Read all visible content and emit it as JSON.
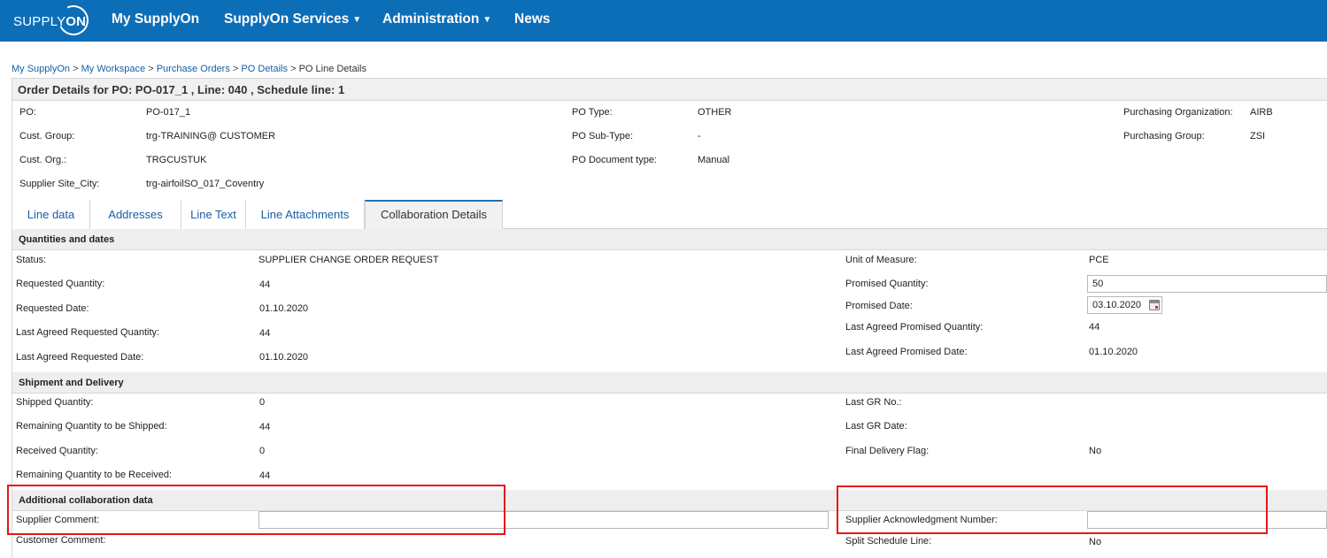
{
  "header": {
    "logo_prefix": "SUPPLY",
    "logo_suffix": "ON",
    "nav": [
      "My SupplyOn",
      "SupplyOn Services",
      "Administration",
      "News"
    ]
  },
  "breadcrumb": {
    "items": [
      "My SupplyOn",
      "My Workspace",
      "Purchase Orders",
      "PO Details"
    ],
    "current": "PO Line Details",
    "separator": ">"
  },
  "title": "Order  Details for PO: PO-017_1 , Line: 040 , Schedule line: 1",
  "po_header": {
    "po_label": "PO:",
    "po_value": "PO-017_1",
    "cust_group_label": "Cust. Group:",
    "cust_group_value": "trg-TRAINING@ CUSTOMER",
    "cust_org_label": "Cust. Org.:",
    "cust_org_value": "TRGCUSTUK",
    "supplier_site_label": "Supplier Site_City:",
    "supplier_site_value": "trg-airfoilSO_017_Coventry",
    "po_type_label": "PO Type:",
    "po_type_value": "OTHER",
    "po_subtype_label": "PO Sub-Type:",
    "po_subtype_value": "-",
    "po_doctype_label": "PO Document type:",
    "po_doctype_value": "Manual",
    "purch_org_label": "Purchasing Organization:",
    "purch_org_value": "AIRB",
    "purch_group_label": "Purchasing Group:",
    "purch_group_value": "ZSI"
  },
  "tabs": [
    "Line data",
    "Addresses",
    "Line Text",
    "Line Attachments",
    "Collaboration Details"
  ],
  "active_tab": "Collaboration Details",
  "quantities": {
    "section_title": "Quantities and dates",
    "status_label": "Status:",
    "status_value": "SUPPLIER CHANGE ORDER REQUEST",
    "req_qty_label": "Requested Quantity:",
    "req_qty_value": "44",
    "req_date_label": "Requested Date:",
    "req_date_value": "01.10.2020",
    "last_req_qty_label": "Last Agreed Requested Quantity:",
    "last_req_qty_value": "44",
    "last_req_date_label": "Last Agreed Requested Date:",
    "last_req_date_value": "01.10.2020",
    "uom_label": "Unit of Measure:",
    "uom_value": "PCE",
    "prom_qty_label": "Promised Quantity:",
    "prom_qty_value": "50",
    "prom_date_label": "Promised Date:",
    "prom_date_value": "03.10.2020",
    "last_prom_qty_label": "Last Agreed Promised Quantity:",
    "last_prom_qty_value": "44",
    "last_prom_date_label": "Last Agreed Promised Date:",
    "last_prom_date_value": "01.10.2020"
  },
  "shipment": {
    "section_title": "Shipment and Delivery",
    "shipped_label": "Shipped Quantity:",
    "shipped_value": "0",
    "remain_ship_label": "Remaining Quantity to be Shipped:",
    "remain_ship_value": "44",
    "received_label": "Received Quantity:",
    "received_value": "0",
    "remain_recv_label": "Remaining Quantity to be Received:",
    "remain_recv_value": "44",
    "last_gr_no_label": "Last GR No.:",
    "last_gr_date_label": "Last GR Date:",
    "final_flag_label": "Final Delivery Flag:",
    "final_flag_value": "No"
  },
  "additional": {
    "section_title": "Additional collaboration data",
    "supplier_comment_label": "Supplier Comment:",
    "supplier_comment_value": "",
    "customer_comment_label": "Customer Comment:",
    "ack_number_label": "Supplier Acknowledgment Number:",
    "ack_number_value": "",
    "split_label": "Split Schedule Line:",
    "split_value": "No"
  },
  "colors": {
    "header_bg": "#0d6eb8",
    "link": "#1a5ea8",
    "highlight": "#e3161a"
  }
}
